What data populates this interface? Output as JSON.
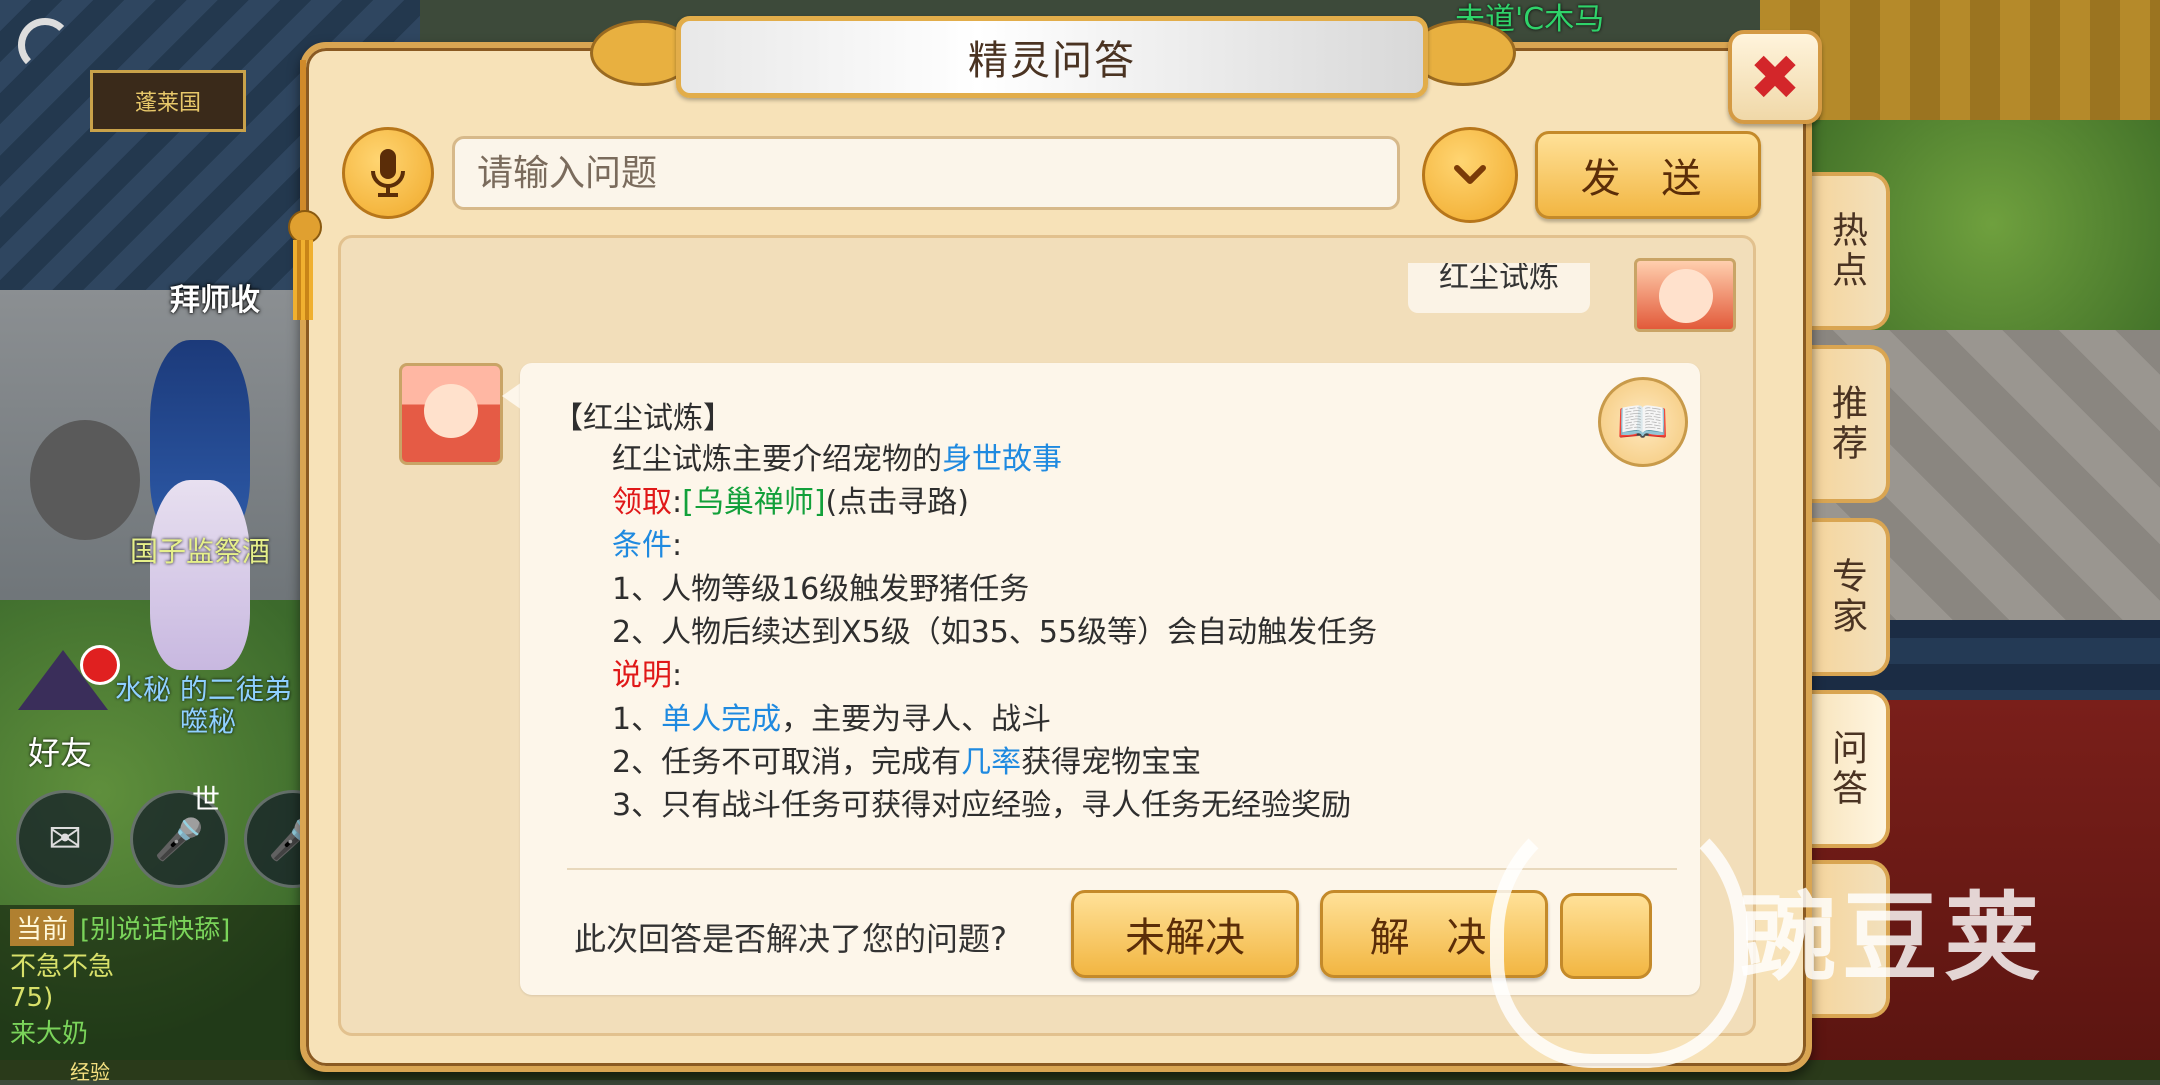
{
  "world": {
    "top_name": "未道'C木马",
    "sign": "蓬莱国",
    "label_master": "拜师收",
    "npc_name_1": "国子监祭酒",
    "npc_name_2": "水秘 的二徒弟",
    "npc_name_3": "噬秘",
    "friend_label": "好友",
    "world_channel": "世",
    "chat_tag": "当前",
    "chat_line_1": "[别说话快舔]",
    "chat_line_2": "不急不急",
    "chat_line_3": "75)",
    "chat_line_4": "来大奶",
    "xp_label": "经验"
  },
  "dialog": {
    "title": "精灵问答",
    "close_icon": "close-icon",
    "search_placeholder": "请输入问题",
    "send_label": "发 送",
    "prev_user_message": "红尘试炼",
    "answer": {
      "heading": "【红尘试炼】",
      "intro_prefix": "红尘试炼主要介绍宠物的",
      "intro_link": "身世故事",
      "receive_label": "领取",
      "receive_colon": ":",
      "receive_npc": "[乌巢禅师]",
      "receive_hint": "(点击寻路)",
      "conditions_label": "条件",
      "conditions_colon": ":",
      "condition_1": "1、人物等级16级触发野猪任务",
      "condition_2": "2、人物后续达到X5级（如35、55级等）会自动触发任务",
      "notes_label": "说明",
      "notes_colon": ":",
      "note_1_prefix": "1、",
      "note_1_link": "单人完成",
      "note_1_suffix": "，主要为寻人、战斗",
      "note_2_prefix": "2、任务不可取消，完成有",
      "note_2_link": "几率",
      "note_2_suffix": "获得宠物宝宝",
      "note_3": "3、只有战斗任务可获得对应经验，寻人任务无经验奖励"
    },
    "feedback_question": "此次回答是否解决了您的问题?",
    "unsolved_label": "未解决",
    "solved_label": "解 决"
  },
  "side_tabs": [
    {
      "label": "热点",
      "active": false
    },
    {
      "label": "推荐",
      "active": false
    },
    {
      "label": "专家",
      "active": false
    },
    {
      "label": "问答",
      "active": true
    }
  ],
  "watermark": "豌豆荚",
  "colors": {
    "link_blue": "#1f8ae0",
    "label_red": "#e01818",
    "npc_green": "#12a03a",
    "button_gold": "#f2b642",
    "panel": "#f7e2b8"
  }
}
